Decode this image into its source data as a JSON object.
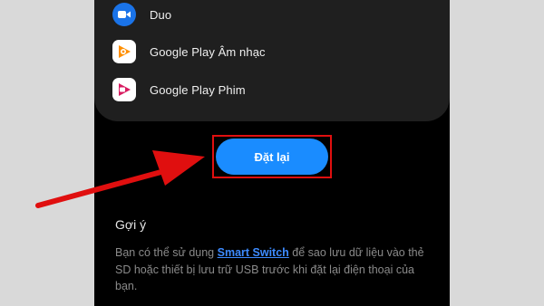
{
  "apps": [
    {
      "label": "Duo",
      "icon": "duo-video-icon"
    },
    {
      "label": "Google Play Âm nhạc",
      "icon": "google-play-music-icon"
    },
    {
      "label": "Google Play Phim",
      "icon": "google-play-movies-icon"
    }
  ],
  "reset_button": {
    "label": "Đặt lại"
  },
  "hint": {
    "title": "Gợi ý",
    "text_before": "Bạn có thể sử dụng ",
    "link": "Smart Switch",
    "text_after": " để sao lưu dữ liệu vào thẻ SD hoặc thiết bị lưu trữ USB trước khi đặt lại điện thoại của bạn."
  },
  "colors": {
    "accent": "#1a8cff",
    "annotation": "#e00f0f",
    "link": "#3d8bff",
    "background": "#000000"
  }
}
